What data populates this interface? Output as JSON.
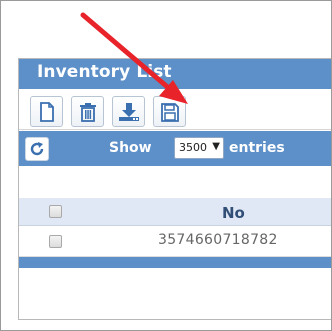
{
  "panel": {
    "title": "Inventory List"
  },
  "toolbar": {
    "buttons": [
      {
        "icon": "new-document-icon"
      },
      {
        "icon": "trash-icon"
      },
      {
        "icon": "download-icon"
      },
      {
        "icon": "save-icon"
      }
    ]
  },
  "controls": {
    "refresh_icon": "refresh-icon",
    "show_label": "Show",
    "page_size": "3500",
    "entries_label": "entries"
  },
  "table": {
    "columns": [
      "No"
    ],
    "rows": [
      {
        "no": "3574660718782"
      }
    ]
  },
  "annotation": {
    "arrow_color": "#e8232a"
  },
  "colors": {
    "accent": "#5d8fc8",
    "header_bg": "#dfe8f4",
    "icon_blue": "#3a6fb0"
  }
}
